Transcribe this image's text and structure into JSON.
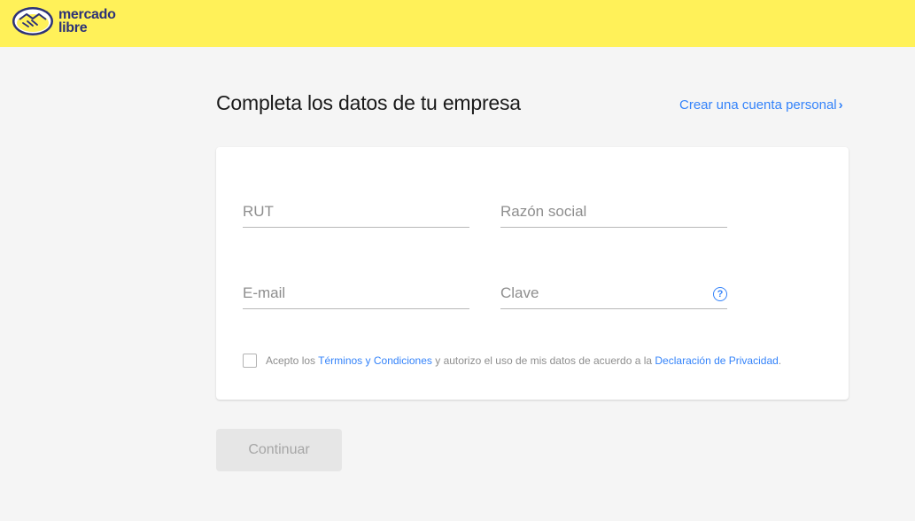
{
  "header": {
    "logo_line1": "mercado",
    "logo_line2": "libre",
    "brand_color": "#fff159",
    "logo_text_color": "#2d3277"
  },
  "page": {
    "title": "Completa los datos de tu empresa",
    "personal_link": "Crear una cuenta personal"
  },
  "form": {
    "rut_placeholder": "RUT",
    "razon_placeholder": "Razón social",
    "email_placeholder": "E-mail",
    "clave_placeholder": "Clave",
    "help_glyph": "?",
    "terms": {
      "prefix": "Acepto los",
      "terms_link": "Términos y Condiciones",
      "middle": "y autorizo el uso de mis datos de acuerdo a la",
      "privacy_link": "Declaración de Privacidad",
      "suffix": "."
    }
  },
  "actions": {
    "continue_label": "Continuar"
  },
  "colors": {
    "accent": "#3483fa",
    "background": "#f5f5f5",
    "disabled_button": "#e6e6e6"
  }
}
